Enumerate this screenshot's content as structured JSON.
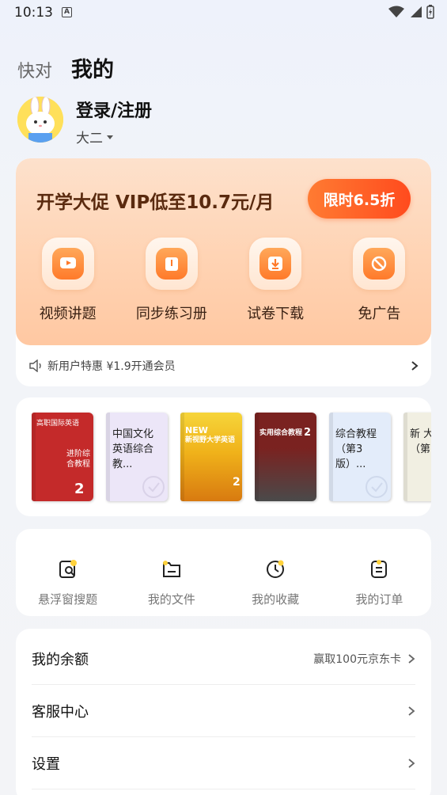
{
  "status_bar": {
    "time": "10:13",
    "notification_icon": "A"
  },
  "tabs": {
    "inactive": "快对",
    "active": "我的"
  },
  "profile": {
    "login_label": "登录/注册",
    "grade": "大二"
  },
  "vip": {
    "title": "开学大促 VIP低至10.7元/月",
    "button": "限时6.5折",
    "features": [
      {
        "label": "视频讲题",
        "icon": "video-play-icon"
      },
      {
        "label": "同步练习册",
        "icon": "workbook-icon"
      },
      {
        "label": "试卷下载",
        "icon": "download-icon"
      },
      {
        "label": "免广告",
        "icon": "no-ads-icon"
      }
    ],
    "promo": "新用户特惠 ¥1.9开通会员",
    "accent": "#ff5a22"
  },
  "books": [
    {
      "title_lines": [
        "高职国际英语",
        "进阶综合教程"
      ],
      "badge": "2",
      "color": "#c42a2a"
    },
    {
      "title": "中国文化英语综合教...",
      "color": "#ece6f8"
    },
    {
      "title_lines": [
        "NEW",
        "新视野大学英语"
      ],
      "badge": "2",
      "color": "#f2b21a"
    },
    {
      "title_lines": [
        "实用综合教程",
        "2"
      ],
      "badge": "2",
      "color": "#7a2220"
    },
    {
      "title": "综合教程（第3版）...",
      "color": "#e3ecfa"
    },
    {
      "title": "新 大学 （第",
      "color": "#f1efe2"
    }
  ],
  "quick_actions": [
    {
      "label": "悬浮窗搜题",
      "icon": "floating-search-icon"
    },
    {
      "label": "我的文件",
      "icon": "folder-icon"
    },
    {
      "label": "我的收藏",
      "icon": "clock-icon"
    },
    {
      "label": "我的订单",
      "icon": "order-icon"
    }
  ],
  "menu": [
    {
      "label": "我的余额",
      "extra": "赢取100元京东卡"
    },
    {
      "label": "客服中心"
    },
    {
      "label": "设置"
    }
  ]
}
